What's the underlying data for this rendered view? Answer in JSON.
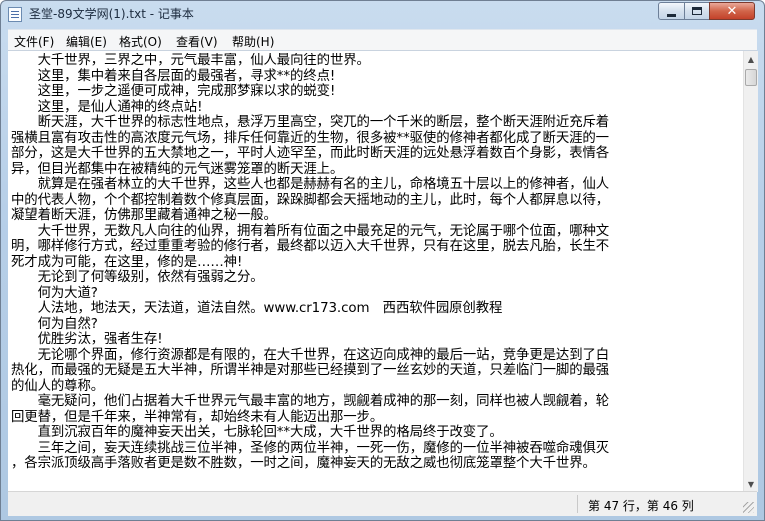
{
  "window": {
    "title": "圣堂-89文学网(1).txt - 记事本",
    "close_label": "✕",
    "icons": [
      "notepad-icon",
      "minimize-icon",
      "maximize-icon",
      "close-icon"
    ]
  },
  "menu": {
    "items": [
      {
        "label": "文件(F)"
      },
      {
        "label": "编辑(E)"
      },
      {
        "label": "格式(O)"
      },
      {
        "label": "查看(V)"
      },
      {
        "label": "帮助(H)"
      }
    ]
  },
  "editor": {
    "lines": [
      "　　大千世界，三界之中，元气最丰富，仙人最向往的世界。",
      "　　这里，集中着来自各层面的最强者，寻求**的终点!",
      "　　这里，一步之遥便可成神，完成那梦寐以求的蜕变!",
      "　　这里，是仙人通神的终点站!",
      "　　断天涯，大千世界的标志性地点，悬浮万里高空，突兀的一个千米的断层，整个断天涯附近充斥着",
      "强横且富有攻击性的高浓度元气场，排斥任何靠近的生物，很多被**驱使的修神者都化成了断天涯的一",
      "部分，这是大千世界的五大禁地之一，平时人迹罕至，而此时断天涯的远处悬浮着数百个身影，表情各",
      "异，但目光都集中在被精纯的元气迷雾笼罩的断天涯上。",
      "　　就算是在强者林立的大千世界，这些人也都是赫赫有名的主儿，命格境五十层以上的修神者，仙人",
      "中的代表人物，个个都控制着数个修真层面，跺跺脚都会天摇地动的主儿，此时，每个人都屏息以待，",
      "凝望着断天涯，仿佛那里藏着通神之秘一般。",
      "　　大千世界，无数凡人向往的仙界，拥有着所有位面之中最充足的元气，无论属于哪个位面，哪种文",
      "明，哪样修行方式，经过重重考验的修行者，最终都以迈入大千世界，只有在这里，脱去凡胎，长生不",
      "死才成为可能，在这里，修的是……神!",
      "　　无论到了何等级别，依然有强弱之分。",
      "　　何为大道?",
      "　　人法地，地法天，天法道，道法自然。www.cr173.com　西西软件园原创教程",
      "　　何为自然?",
      "　　优胜劣汰，强者生存!",
      "　　无论哪个界面，修行资源都是有限的，在大千世界，在这迈向成神的最后一站，竞争更是达到了白",
      "热化，而最强的无疑是五大半神，所谓半神是对那些已经摸到了一丝玄妙的天道，只差临门一脚的最强",
      "的仙人的尊称。",
      "　　毫无疑问，他们占据着大千世界元气最丰富的地方，觊觎着成神的那一刻，同样也被人觊觎着，轮",
      "回更替，但是千年来，半神常有，却始终未有人能迈出那一步。",
      "　　直到沉寂百年的魔神妄天出关，七脉轮回**大成，大千世界的格局终于改变了。",
      "　　三年之间，妄天连续挑战三位半神，圣修的两位半神，一死一伤，魔修的一位半神被吞噬命魂俱灭",
      "，各宗派顶级高手落败者更是数不胜数，一时之间，魔神妄天的无敌之威也彻底笼罩整个大千世界。",
      "　　"
    ]
  },
  "status": {
    "position": "第 47 行，第 46 列"
  }
}
